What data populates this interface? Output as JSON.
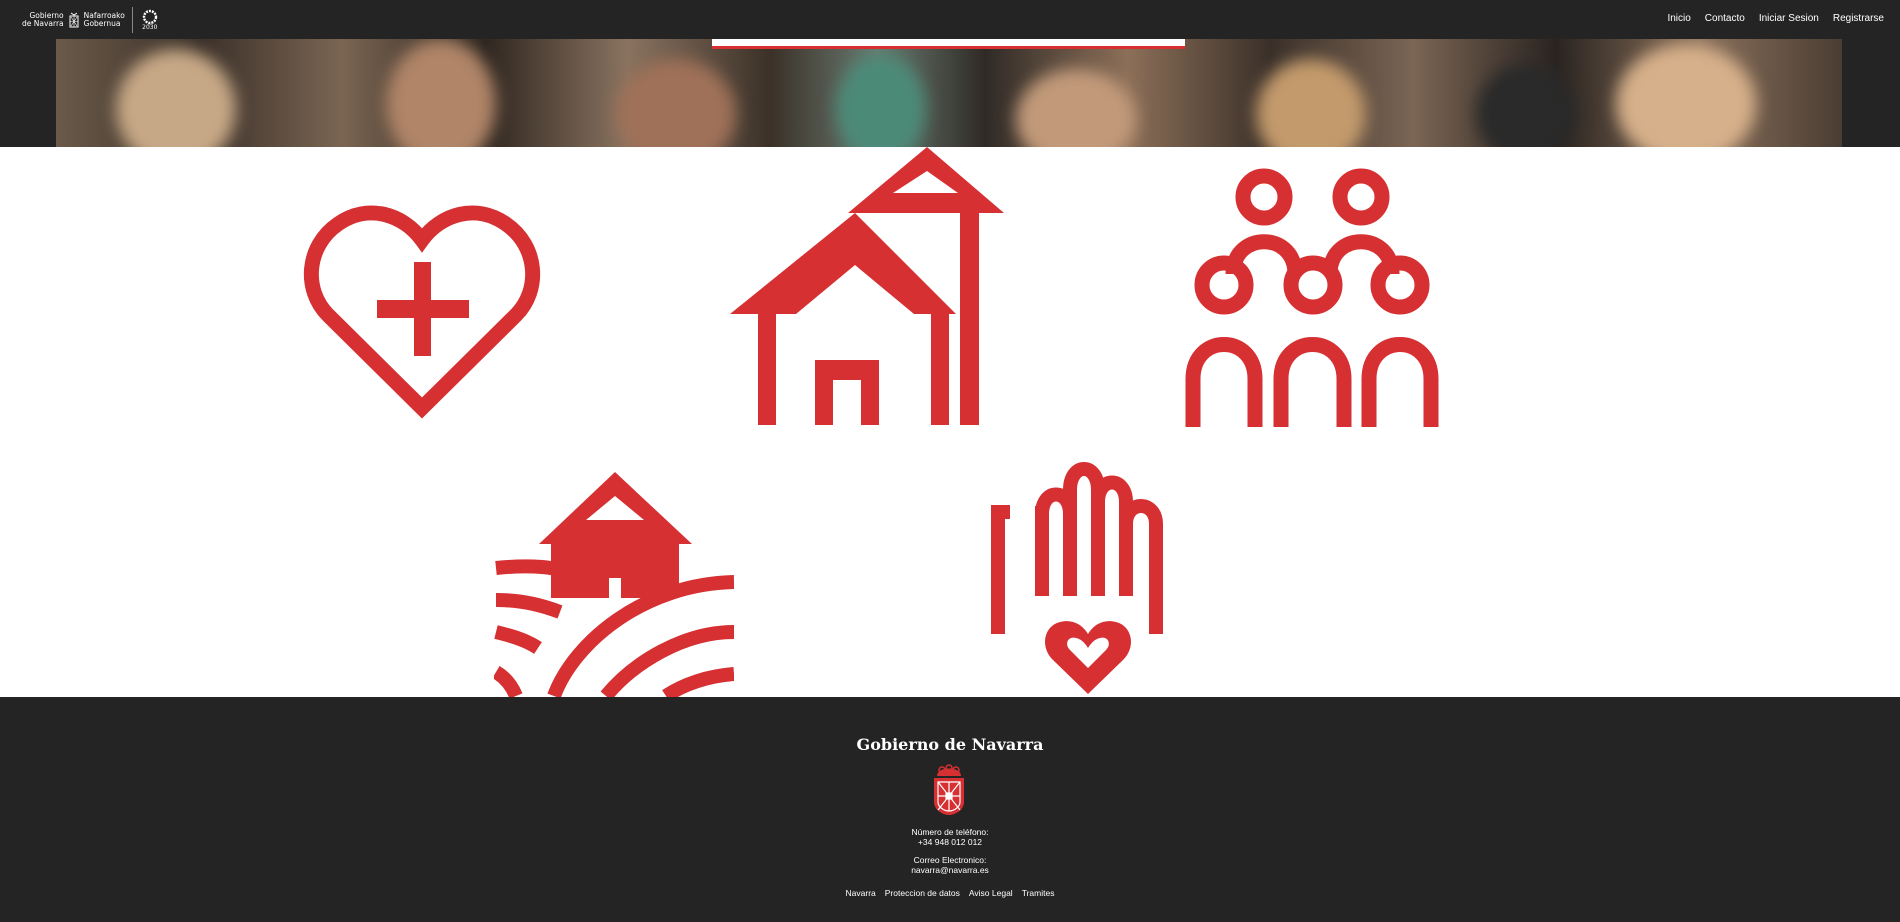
{
  "header": {
    "logo": {
      "line1a": "Gobierno",
      "line1b": "de Navarra",
      "line2a": "Nafarroako",
      "line2b": "Gobernua",
      "badge": "2030"
    },
    "nav": [
      "Inicio",
      "Contacto",
      "Iniciar Sesion",
      "Registrarse"
    ]
  },
  "icons": [
    "heart-health-icon",
    "house-icon",
    "family-group-icon",
    "rural-house-icon",
    "hand-heart-icon"
  ],
  "footer": {
    "title": "Gobierno de Navarra",
    "phone_label": "Número de teléfono:",
    "phone": "+34 948 012 012",
    "email_label": "Correo Electronico:",
    "email": "navarra@navarra.es",
    "links": [
      "Navarra",
      "Proteccion de datos",
      "Aviso Legal",
      "Tramites"
    ]
  },
  "colors": {
    "accent": "#d63033",
    "dark": "#242424"
  }
}
